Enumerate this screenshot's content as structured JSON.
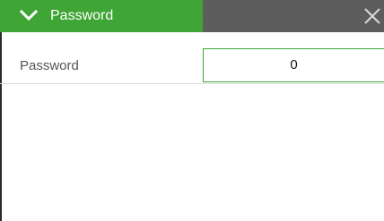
{
  "header": {
    "title": "Password",
    "chevron_icon": "chevron-down-icon",
    "close_icon": "close-icon",
    "accent_color": "#3fa535",
    "bar_color": "#5a5a5a"
  },
  "field": {
    "label": "Password",
    "value": "0"
  }
}
